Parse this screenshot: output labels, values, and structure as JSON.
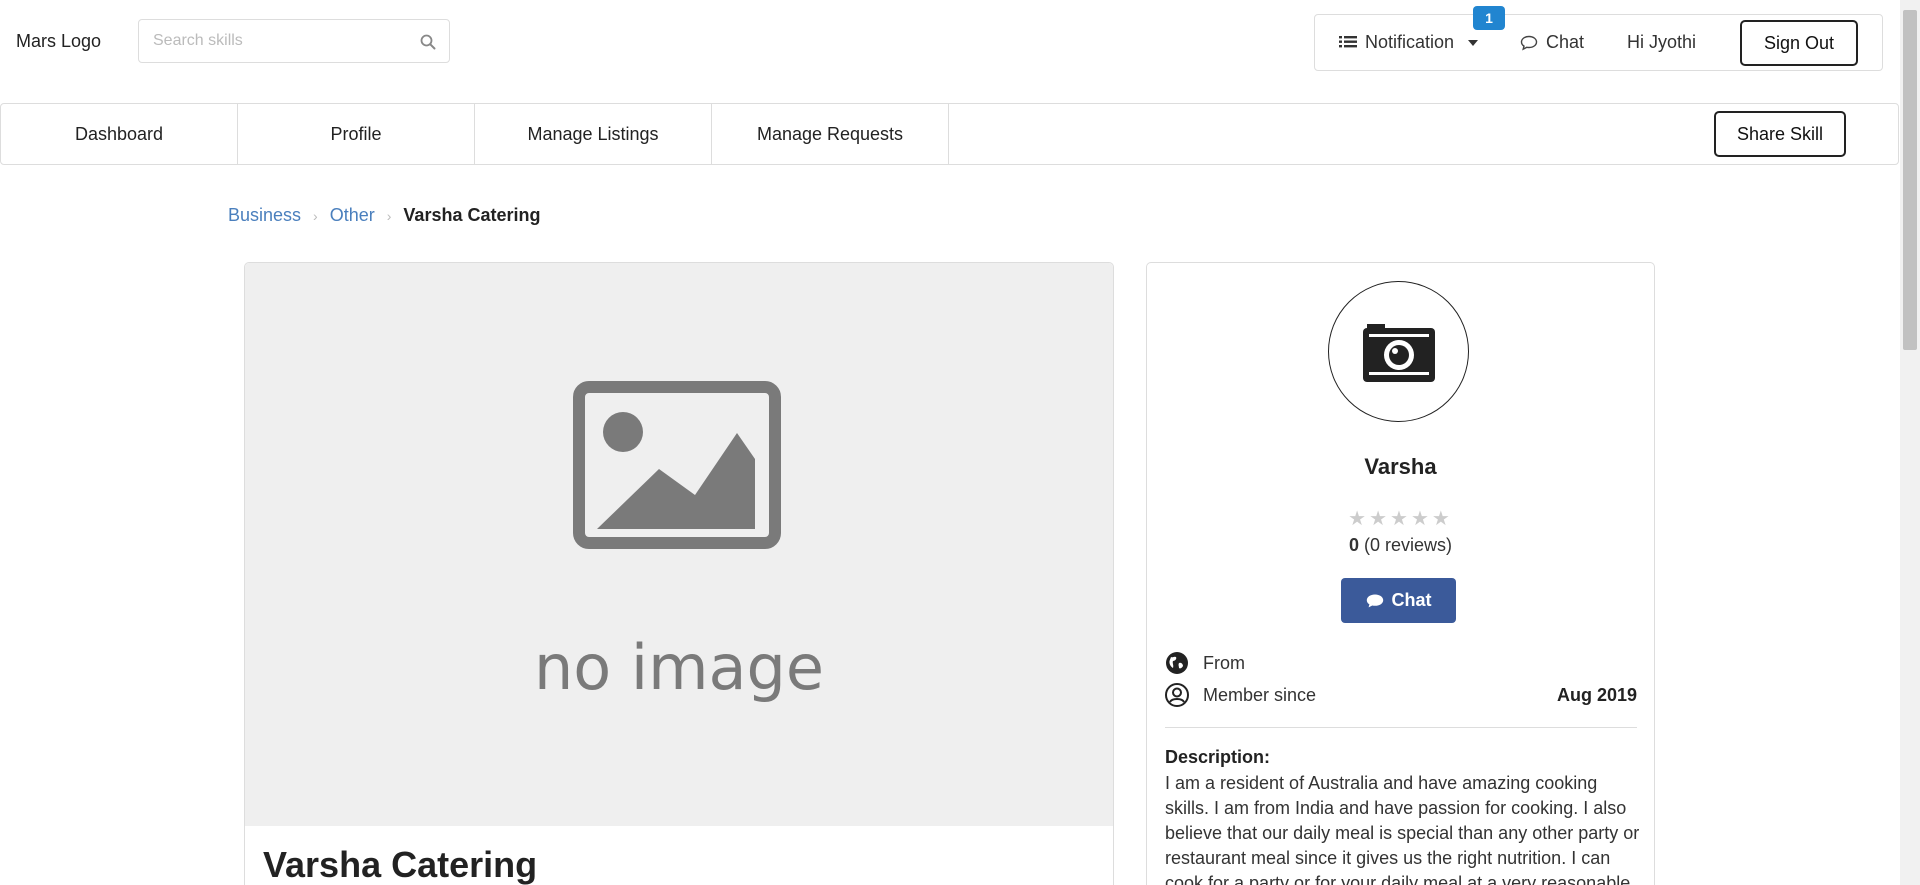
{
  "header": {
    "logo": "Mars Logo",
    "search_placeholder": "Search skills",
    "notification_label": "Notification",
    "notification_count": "1",
    "chat_label": "Chat",
    "greeting": "Hi Jyothi",
    "signout_label": "Sign Out"
  },
  "nav": {
    "items": [
      {
        "label": "Dashboard"
      },
      {
        "label": "Profile"
      },
      {
        "label": "Manage Listings"
      },
      {
        "label": "Manage Requests"
      }
    ],
    "share_skill_label": "Share Skill"
  },
  "breadcrumb": {
    "items": [
      "Business",
      "Other"
    ],
    "current": "Varsha Catering"
  },
  "listing": {
    "image_text": "no image",
    "title": "Varsha Catering"
  },
  "seller": {
    "name": "Varsha",
    "rating_value": 0,
    "rating_max": 5,
    "rating": "0",
    "reviews": "(0 reviews)",
    "chat_label": "Chat",
    "from_label": "From",
    "member_since_label": "Member since",
    "member_since_value": "Aug 2019",
    "description_label": "Description:",
    "description": "I am a resident of Australia and have amazing cooking skills. I am from India and have passion for cooking. I also believe that our daily meal is special than any other party or restaurant meal since it gives us the right nutrition. I can cook for a party or for your daily meal at a very reasonable price. Please"
  },
  "colors": {
    "accent": "#3b5a9a",
    "badge": "#2185d0",
    "link": "#4a7fbd"
  }
}
